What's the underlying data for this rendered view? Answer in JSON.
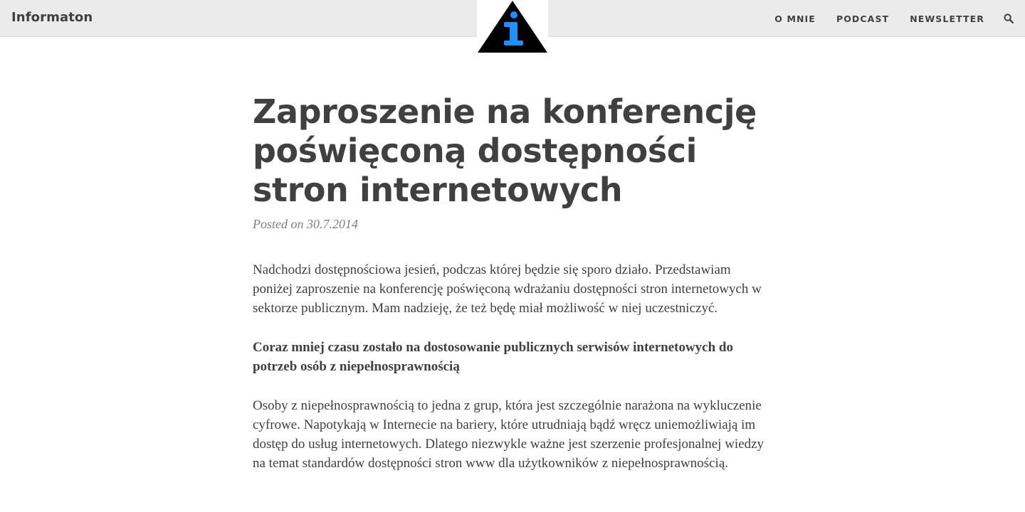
{
  "site": {
    "title": "Informaton"
  },
  "logo": {
    "icon": "info-triangle-logo",
    "colors": {
      "triangle": "#000000",
      "glyph": "#1e90ff"
    }
  },
  "nav": {
    "items": [
      {
        "label": "O MNIE"
      },
      {
        "label": "PODCAST"
      },
      {
        "label": "NEWSLETTER"
      }
    ],
    "search_icon": "search-icon"
  },
  "post": {
    "title": "Zaproszenie na konferencję poświęconą dostępności stron internetowych",
    "meta": "Posted on 30.7.2014",
    "paragraphs": [
      "Nadchodzi dostępnościowa jesień, podczas której będzie się sporo działo. Przedstawiam poniżej zaproszenie na konferencję poświęconą wdrażaniu dostępności stron internetowych w sektorze publicznym. Mam nadzieję, że też będę miał możliwość w niej uczestniczyć.",
      "Coraz mniej czasu zostało na dostosowanie publicznych serwisów internetowych do potrzeb osób z niepełnosprawnością",
      "Osoby z niepełnosprawnością to jedna z grup, która jest szczególnie narażona na wykluczenie cyfrowe. Napotykają w Internecie na bariery, które utrudniają bądź wręcz uniemożliwiają im dostęp do usług internetowych. Dlatego niezwykle ważne jest szerzenie profesjonalnej wiedzy na temat standardów dostępności stron www dla użytkowników z niepełnosprawnością."
    ]
  },
  "colors": {
    "topbar_bg": "#ebebeb",
    "text": "#404040",
    "meta": "#808080"
  }
}
